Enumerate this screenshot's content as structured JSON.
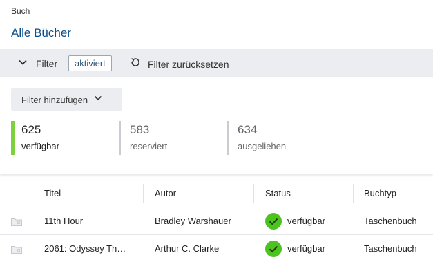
{
  "breadcrumb": "Buch",
  "page_title": "Alle Bücher",
  "filterbar": {
    "filter_label": "Filter",
    "active_badge": "aktiviert",
    "reset_label": "Filter zurücksetzen"
  },
  "add_filter_label": "Filter hinzufügen",
  "stats": [
    {
      "count": "625",
      "label": "verfügbar"
    },
    {
      "count": "583",
      "label": "reserviert"
    },
    {
      "count": "634",
      "label": "ausgeliehen"
    }
  ],
  "table": {
    "columns": [
      "Titel",
      "Autor",
      "Status",
      "Buchtyp"
    ],
    "rows": [
      {
        "title": "11th Hour",
        "author": "Bradley Warshauer",
        "status": "verfügbar",
        "type": "Taschenbuch"
      },
      {
        "title": "2061: Odyssey Th…",
        "author": "Arthur C. Clarke",
        "status": "verfügbar",
        "type": "Taschenbuch"
      }
    ]
  },
  "colors": {
    "title_blue": "#0b4f8a",
    "active_green": "#7dd13e",
    "status_green": "#4cc31f",
    "filterbar_bg": "#ebedf0"
  }
}
